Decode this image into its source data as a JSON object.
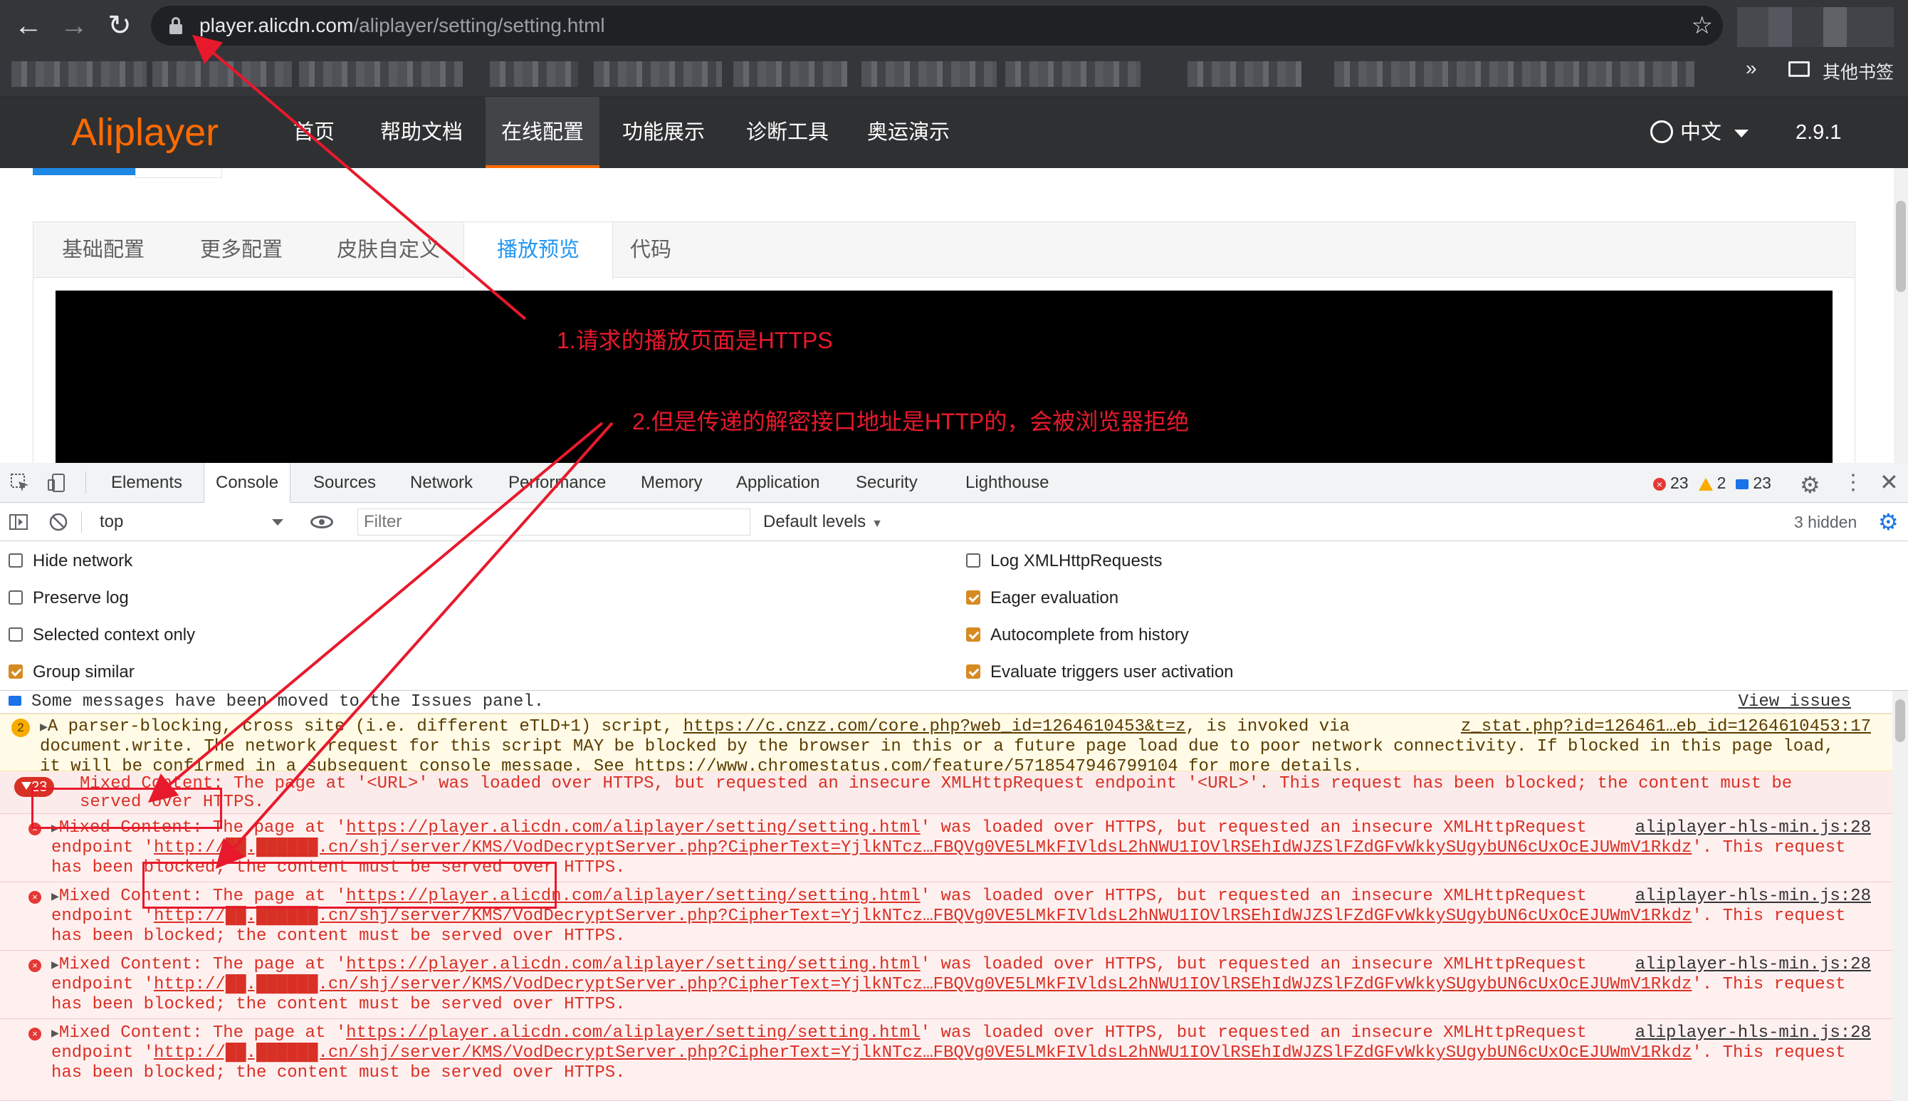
{
  "browser": {
    "url_host": "player.alicdn.com",
    "url_path": "/aliplayer/setting/setting.html",
    "bookmarks_more": "»",
    "other_bookmarks": "其他书签",
    "icons": [
      "back-icon",
      "forward-icon",
      "reload-icon",
      "lock-icon",
      "star-icon",
      "folder-icon"
    ]
  },
  "page": {
    "logo": "Aliplayer",
    "nav": [
      "首页",
      "帮助文档",
      "在线配置",
      "功能展示",
      "诊断工具",
      "奥运演示"
    ],
    "nav_active": "在线配置",
    "lang": "中文",
    "version": "2.9.1",
    "subtabs": [
      "基础配置",
      "更多配置",
      "皮肤自定义",
      "播放预览",
      "代码"
    ],
    "subtab_active": "播放预览"
  },
  "devtools": {
    "tabs": [
      "Elements",
      "Console",
      "Sources",
      "Network",
      "Performance",
      "Memory",
      "Application",
      "Security",
      "Lighthouse"
    ],
    "active_tab": "Console",
    "error_count": "23",
    "warning_count": "2",
    "info_count": "23",
    "context": "top",
    "filter_placeholder": "Filter",
    "levels": "Default levels",
    "hidden": "3 hidden",
    "settings_left": [
      {
        "label": "Hide network",
        "checked": false
      },
      {
        "label": "Preserve log",
        "checked": false
      },
      {
        "label": "Selected context only",
        "checked": false
      },
      {
        "label": "Group similar",
        "checked": true
      }
    ],
    "settings_right": [
      {
        "label": "Log XMLHttpRequests",
        "checked": false
      },
      {
        "label": "Eager evaluation",
        "checked": true
      },
      {
        "label": "Autocomplete from history",
        "checked": true
      },
      {
        "label": "Evaluate triggers user activation",
        "checked": true
      }
    ],
    "colors": {
      "error": "#d93025",
      "warning_bg": "#fffbe6",
      "accent": "#d68a22"
    }
  },
  "console": {
    "info": {
      "text": "Some messages have been moved to the Issues panel.",
      "link": "View issues"
    },
    "warning": {
      "count": "2",
      "line1_a": "A parser-blocking, cross site (i.e. different eTLD+1) script, ",
      "line1_link": "https://c.cnzz.com/core.php?web_id=1264610453&t=z",
      "line1_b": ", is invoked via",
      "source": "z_stat.php?id=126461…eb_id=1264610453:17",
      "line2": "document.write. The network request for this script MAY be blocked by the browser in this or a future page load due to poor network connectivity. If blocked in this page load,",
      "line3_a": "it will be confirmed in a subsequent console message. See ",
      "line3_link": "https://www.chromestatus.com/feature/5718547946799104",
      "line3_b": " for more details."
    },
    "group": {
      "count": "23",
      "line1": "Mixed Content: The page at '<URL>' was loaded over HTTPS, but requested an insecure XMLHttpRequest endpoint '<URL>'. This request has been blocked; the content must be",
      "line2": "served over HTTPS."
    },
    "errors": [
      {
        "a": "Mixed Content: The page at '",
        "page_link": "https://player.alicdn.com/aliplayer/setting/setting.html",
        "b": "' was loaded over HTTPS, but requested an insecure XMLHttpRequest",
        "source": "aliplayer-hls-min.js:28",
        "c": "endpoint '",
        "endpoint": "http://██.██████.cn/shj/server/KMS/VodDecryptServer.php?CipherText=YjlkNTcz…FBQVg0VE5LMkFIVldsL2hNWU1IOVlRSEhIdWJZSlFZdGFvWkkySUgybUN6cUxOcEJUWmV1Rkdz",
        "d": "'. This request",
        "e": "has been blocked; the content must be served over HTTPS."
      },
      {
        "a": "Mixed Content: The page at '",
        "page_link": "https://player.alicdn.com/aliplayer/setting/setting.html",
        "b": "' was loaded over HTTPS, but requested an insecure XMLHttpRequest",
        "source": "aliplayer-hls-min.js:28",
        "c": "endpoint '",
        "endpoint": "http://██.██████.cn/shj/server/KMS/VodDecryptServer.php?CipherText=YjlkNTcz…FBQVg0VE5LMkFIVldsL2hNWU1IOVlRSEhIdWJZSlFZdGFvWkkySUgybUN6cUxOcEJUWmV1Rkdz",
        "d": "'. This request",
        "e": "has been blocked; the content must be served over HTTPS."
      },
      {
        "a": "Mixed Content: The page at '",
        "page_link": "https://player.alicdn.com/aliplayer/setting/setting.html",
        "b": "' was loaded over HTTPS, but requested an insecure XMLHttpRequest",
        "source": "aliplayer-hls-min.js:28",
        "c": "endpoint '",
        "endpoint": "http://██.██████.cn/shj/server/KMS/VodDecryptServer.php?CipherText=YjlkNTcz…FBQVg0VE5LMkFIVldsL2hNWU1IOVlRSEhIdWJZSlFZdGFvWkkySUgybUN6cUxOcEJUWmV1Rkdz",
        "d": "'. This request",
        "e": "has been blocked; the content must be served over HTTPS."
      },
      {
        "a": "Mixed Content: The page at '",
        "page_link": "https://player.alicdn.com/aliplayer/setting/setting.html",
        "b": "' was loaded over HTTPS, but requested an insecure XMLHttpRequest",
        "source": "aliplayer-hls-min.js:28",
        "c": "endpoint '",
        "endpoint": "http://██.██████.cn/shj/server/KMS/VodDecryptServer.php?CipherText=YjlkNTcz…FBQVg0VE5LMkFIVldsL2hNWU1IOVlRSEhIdWJZSlFZdGFvWkkySUgybUN6cUxOcEJUWmV1Rkdz",
        "d": "'. This request",
        "e": "has been blocked; the content must be served over HTTPS."
      }
    ]
  },
  "annotations": {
    "note1": "1.请求的播放页面是HTTPS",
    "note2": "2.但是传递的解密接口地址是HTTP的，会被浏览器拒绝",
    "color": "#e8192c"
  }
}
